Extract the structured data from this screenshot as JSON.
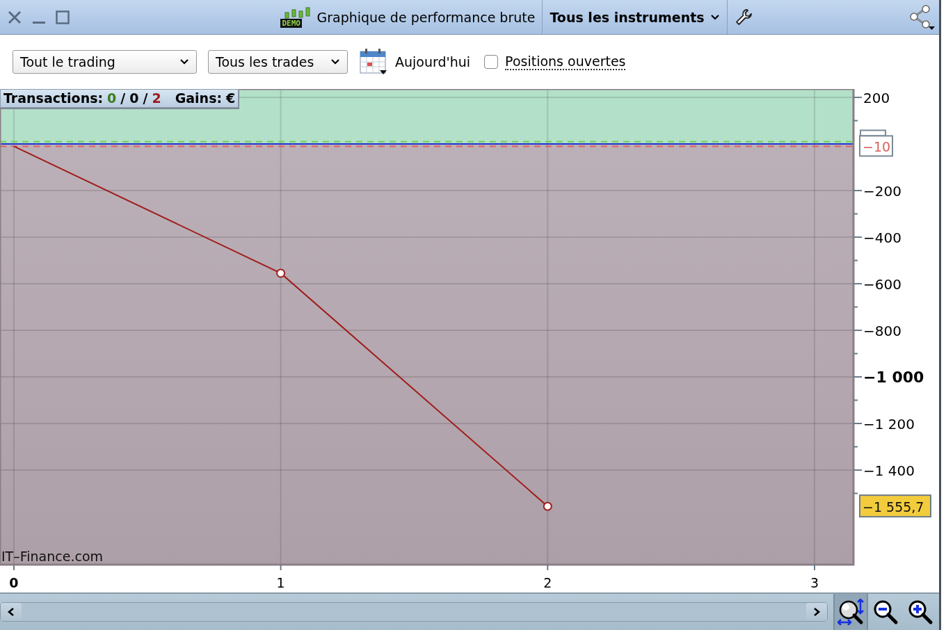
{
  "window": {
    "title": "Graphique de performance brute",
    "demo_badge": "DEMO",
    "instrument_menu": {
      "label": "Tous les instruments"
    }
  },
  "toolbar": {
    "filters": [
      {
        "value": "Tout le trading"
      },
      {
        "value": "Tous les trades"
      }
    ],
    "date_label": "Aujourd'hui",
    "open_positions": {
      "label": "Positions ouvertes",
      "checked": false
    }
  },
  "stats": {
    "label": "Transactions:",
    "separator": "/",
    "counts": [
      {
        "value": "0",
        "color": "#3a7d20"
      },
      {
        "value": "0",
        "color": "#000000"
      },
      {
        "value": "2",
        "color": "#a01c1c"
      }
    ],
    "gains_label": "Gains:",
    "gains_value": "€"
  },
  "chart": {
    "brand": "IT–Finance.com",
    "chart_data": {
      "type": "line",
      "x": [
        0,
        1,
        2
      ],
      "series": [
        {
          "color": "#a01c1c",
          "values": [
            -10,
            -555,
            -1555.7
          ]
        }
      ],
      "xlim": [
        -0.052,
        3.146
      ],
      "ylim": [
        -1806,
        236
      ],
      "grid": true,
      "xticks": [
        {
          "value": 0,
          "label": "0"
        },
        {
          "value": 1,
          "label": "1"
        },
        {
          "value": 2,
          "label": "2"
        },
        {
          "value": 3,
          "label": "3"
        }
      ],
      "yticks": [
        {
          "value": 200,
          "label": "200"
        },
        {
          "value": -200,
          "label": "−200"
        },
        {
          "value": -400,
          "label": "−400"
        },
        {
          "value": -600,
          "label": "−600"
        },
        {
          "value": -800,
          "label": "−800"
        },
        {
          "value": -1000,
          "label": "−1 000"
        },
        {
          "value": -1200,
          "label": "−1 200"
        },
        {
          "value": -1400,
          "label": "−1 400"
        }
      ],
      "bands": [
        {
          "axis": "y",
          "from": 0,
          "to": 236,
          "color": "#b3e0c9"
        },
        {
          "axis": "y",
          "from": -1806,
          "to": 0,
          "color": "#bcb0b8"
        }
      ],
      "ref_lines": [
        {
          "axis": "y",
          "value": 10,
          "color": "#6ccf5a"
        },
        {
          "axis": "y",
          "value": 0,
          "color": "#2233cc"
        },
        {
          "axis": "y",
          "value": -10,
          "color": "#e06060"
        }
      ],
      "annotations": [
        "−10",
        "−1 555,7"
      ]
    }
  },
  "bottom_bar": {
    "tools": [
      {
        "kind": "zoom-fit",
        "selected": true
      },
      {
        "kind": "zoom-out",
        "selected": false
      },
      {
        "kind": "zoom-in",
        "selected": false
      }
    ]
  }
}
